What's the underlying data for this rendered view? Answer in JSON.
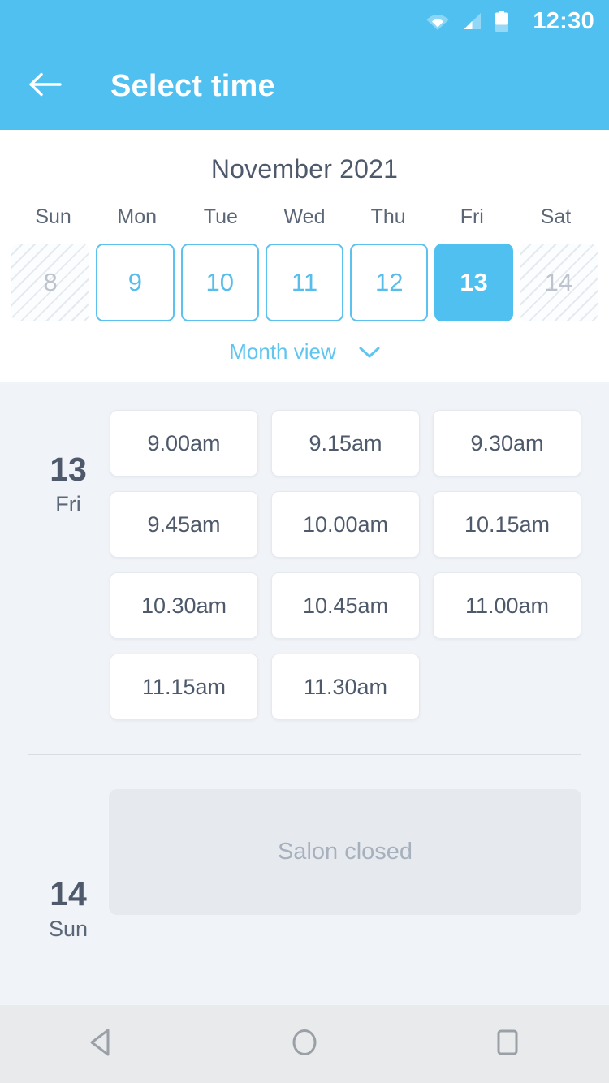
{
  "status_bar": {
    "time": "12:30",
    "icons": [
      "wifi-icon",
      "signal-icon",
      "battery-icon"
    ]
  },
  "app_bar": {
    "back_icon": "arrow-left-icon",
    "title": "Select time"
  },
  "calendar": {
    "month_label": "November 2021",
    "weekdays": [
      "Sun",
      "Mon",
      "Tue",
      "Wed",
      "Thu",
      "Fri",
      "Sat"
    ],
    "days": [
      {
        "number": "8",
        "state": "disabled"
      },
      {
        "number": "9",
        "state": "available"
      },
      {
        "number": "10",
        "state": "available"
      },
      {
        "number": "11",
        "state": "available"
      },
      {
        "number": "12",
        "state": "available"
      },
      {
        "number": "13",
        "state": "selected"
      },
      {
        "number": "14",
        "state": "disabled"
      }
    ],
    "month_view_label": "Month view",
    "month_view_icon": "chevron-down-icon"
  },
  "schedule": [
    {
      "day_number": "13",
      "day_of_week": "Fri",
      "slots": [
        "9.00am",
        "9.15am",
        "9.30am",
        "9.45am",
        "10.00am",
        "10.15am",
        "10.30am",
        "10.45am",
        "11.00am",
        "11.15am",
        "11.30am"
      ]
    },
    {
      "day_number": "14",
      "day_of_week": "Sun",
      "closed_label": "Salon closed"
    }
  ],
  "nav_bar": {
    "back_icon": "triangle-back-icon",
    "home_icon": "circle-home-icon",
    "recents_icon": "square-recents-icon"
  },
  "colors": {
    "accent": "#4fc0f0",
    "accent_border": "#5bc2ef",
    "text_dark": "#4e5a6b",
    "text_muted": "#a7b0bd",
    "page_bg": "#f0f3f7",
    "closed_bg": "#e6eaef",
    "nav_bg": "#e8eaec"
  }
}
